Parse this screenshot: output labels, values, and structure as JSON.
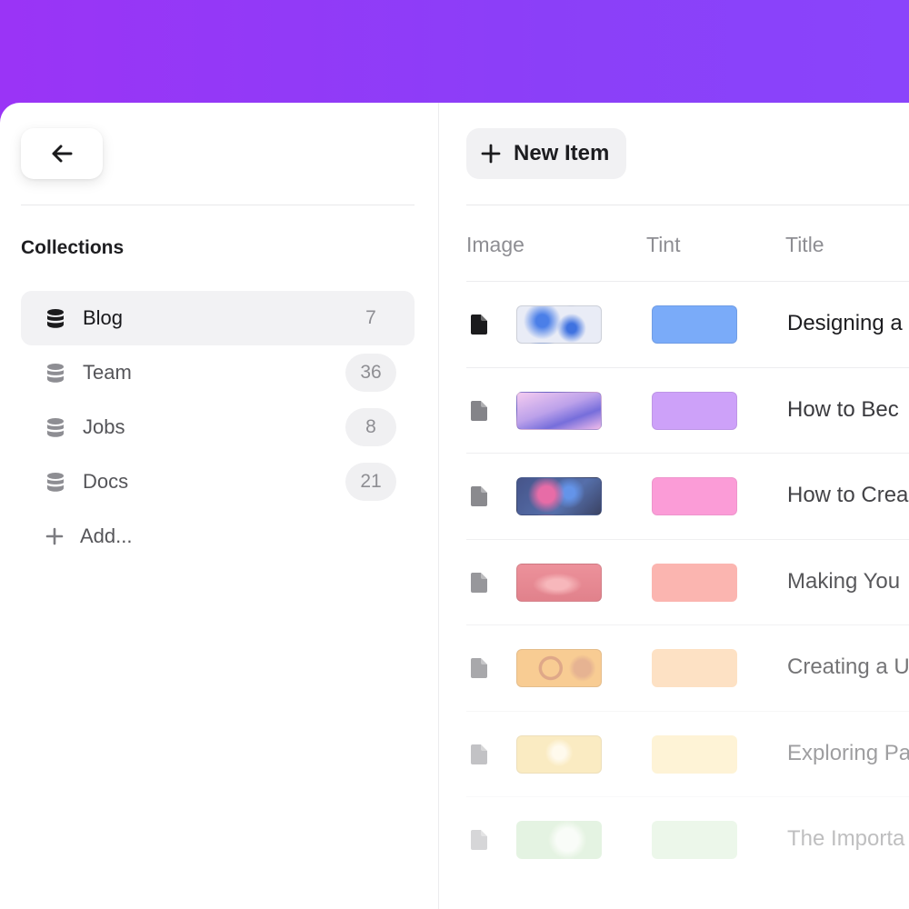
{
  "sidebar": {
    "back_icon": "arrow-left-icon",
    "heading": "Collections",
    "items": [
      {
        "label": "Blog",
        "count": "7",
        "active": true,
        "icon": "database-icon"
      },
      {
        "label": "Team",
        "count": "36",
        "active": false,
        "icon": "database-icon"
      },
      {
        "label": "Jobs",
        "count": "8",
        "active": false,
        "icon": "database-icon"
      },
      {
        "label": "Docs",
        "count": "21",
        "active": false,
        "icon": "database-icon"
      }
    ],
    "add_label": "Add..."
  },
  "toolbar": {
    "new_item_label": "New Item",
    "new_item_icon": "plus-icon"
  },
  "table": {
    "columns": [
      "Image",
      "Tint",
      "Title"
    ],
    "rows": [
      {
        "title": "Designing a",
        "tint": "#7aabf9",
        "thumb_colors": [
          "#e9ecf6",
          "#4b7fe8"
        ],
        "icon": "document-icon"
      },
      {
        "title": "How to Bec",
        "tint": "#c99af9",
        "thumb_colors": [
          "#f3c7ef",
          "#6b62d9"
        ],
        "icon": "document-icon"
      },
      {
        "title": "How to Crea",
        "tint": "#fb8fd2",
        "thumb_colors": [
          "#3f5c9f",
          "#e4589b"
        ],
        "icon": "document-icon"
      },
      {
        "title": "Making You",
        "tint": "#fba19b",
        "thumb_colors": [
          "#e8737f",
          "#f5a3a8"
        ],
        "icon": "document-icon"
      },
      {
        "title": "Creating a U",
        "tint": "#fdd2a5",
        "thumb_colors": [
          "#f5b15a",
          "#cf7b4a"
        ],
        "icon": "document-icon"
      },
      {
        "title": "Exploring Pa",
        "tint": "#fdf0cc",
        "thumb_colors": [
          "#fbe6a2",
          "#fff4d8"
        ],
        "icon": "document-icon"
      },
      {
        "title": "The Importa",
        "tint": "#e6f3e4",
        "thumb_colors": [
          "#d9efd3",
          "#eef8ea"
        ],
        "icon": "document-icon"
      }
    ]
  }
}
